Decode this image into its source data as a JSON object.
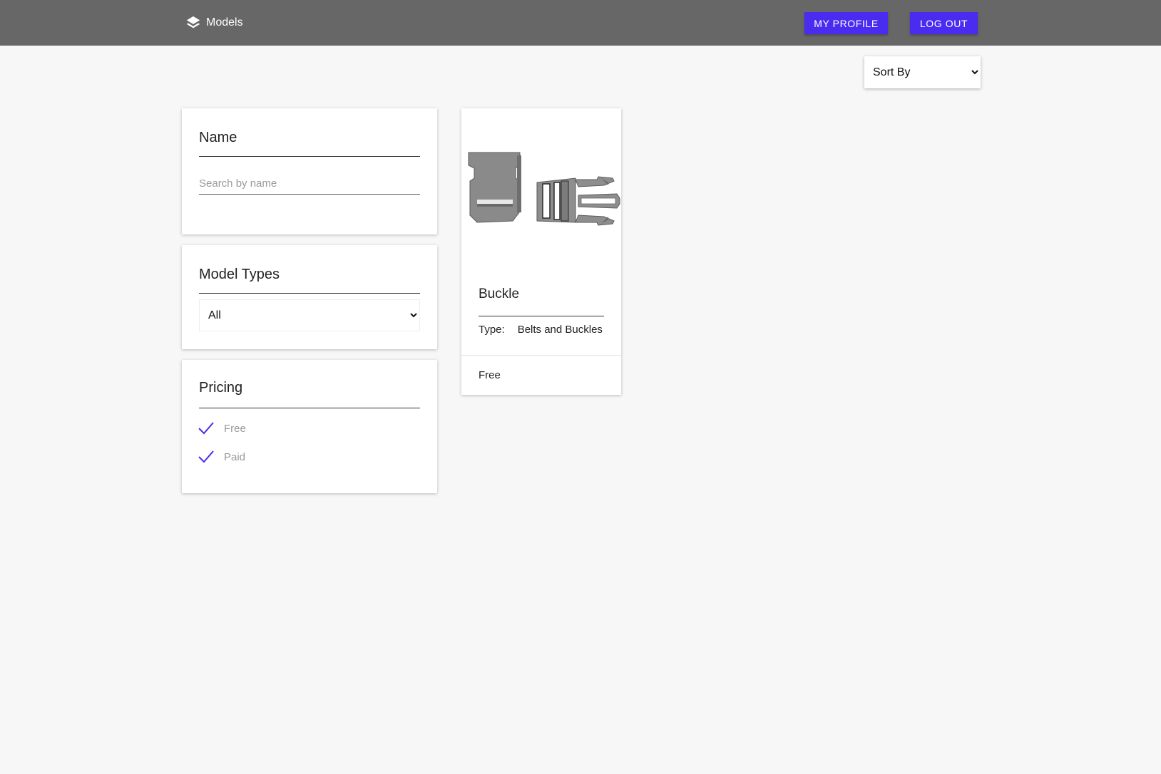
{
  "header": {
    "brand_label": "Models",
    "brand_icon": "layers-icon",
    "profile_button": "MY PROFILE",
    "logout_button": "LOG OUT",
    "accent_color": "#4a2cf0",
    "bar_color": "#676767"
  },
  "sort": {
    "selected": "Sort By"
  },
  "filters": {
    "name": {
      "title": "Name",
      "placeholder": "Search by name",
      "value": ""
    },
    "model_types": {
      "title": "Model Types",
      "selected": "All"
    },
    "pricing": {
      "title": "Pricing",
      "options": [
        {
          "label": "Free",
          "checked": true
        },
        {
          "label": "Paid",
          "checked": true
        }
      ]
    }
  },
  "models": [
    {
      "title": "Buckle",
      "type_label": "Type:",
      "type_value": "Belts and Buckles",
      "price": "Free"
    }
  ]
}
